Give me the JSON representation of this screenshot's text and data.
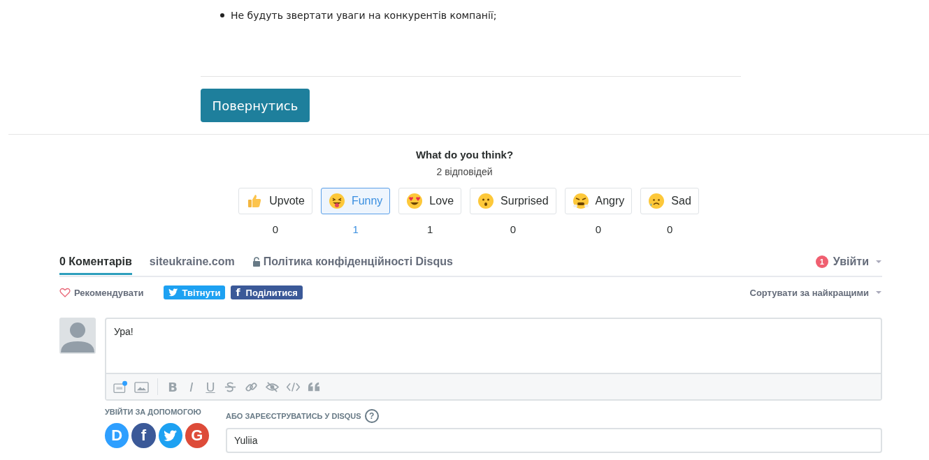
{
  "article": {
    "bullets": [
      "Не будуть звертати уваги на конкурентів компанії;"
    ],
    "back_button": "Повернутись"
  },
  "reactions": {
    "title": "What do you think?",
    "responses": "2 відповідей",
    "items": [
      {
        "kind": "thumb",
        "label": "Upvote",
        "count": "0",
        "selected": false
      },
      {
        "kind": "funny",
        "label": "Funny",
        "count": "1",
        "selected": true
      },
      {
        "kind": "love",
        "label": "Love",
        "count": "1",
        "selected": false
      },
      {
        "kind": "surprised",
        "label": "Surprised",
        "count": "0",
        "selected": false
      },
      {
        "kind": "angry",
        "label": "Angry",
        "count": "0",
        "selected": false
      },
      {
        "kind": "sad",
        "label": "Sad",
        "count": "0",
        "selected": false
      }
    ]
  },
  "nav": {
    "tabs": [
      {
        "kind": "plain",
        "label": "0 Коментарів",
        "selected": true
      },
      {
        "kind": "plain",
        "label": "siteukraine.com",
        "selected": false
      },
      {
        "kind": "lock",
        "label": "Політика конфіденційності Disqus",
        "selected": false
      }
    ],
    "notifications": "1",
    "login": "Увійти"
  },
  "actions": {
    "recommend": "Рекомендувати",
    "share": [
      {
        "kind": "twitter",
        "label": "Твітнути"
      },
      {
        "kind": "facebook",
        "icon": "f",
        "label": "Поділитися"
      }
    ],
    "sort": "Сортувати за найкращими"
  },
  "composer": {
    "value": "Ура!",
    "toolbar": [
      {
        "kind": "gif"
      },
      {
        "kind": "image"
      },
      {
        "kind": "sep"
      },
      {
        "kind": "char",
        "text": "B"
      },
      {
        "kind": "char",
        "text": "I"
      },
      {
        "kind": "char",
        "text": "U"
      },
      {
        "kind": "strike"
      },
      {
        "kind": "link"
      },
      {
        "kind": "eye"
      },
      {
        "kind": "code"
      },
      {
        "kind": "quote"
      }
    ]
  },
  "signin": {
    "with_label": "УВІЙТИ ЗА ДОПОМОГОЮ",
    "services": [
      {
        "kind": "letter",
        "text": "D",
        "color": "#2e9fff"
      },
      {
        "kind": "letter",
        "text": "f",
        "color": "#3b5998"
      },
      {
        "kind": "bird",
        "color": "#1da1f2"
      },
      {
        "kind": "letter",
        "text": "G",
        "color": "#dd4b39"
      }
    ],
    "register_label": "АБО ЗАРЕЄСТРУВАТИСЬ У DISQUS",
    "help": "?",
    "name_value": "Yuliia"
  }
}
